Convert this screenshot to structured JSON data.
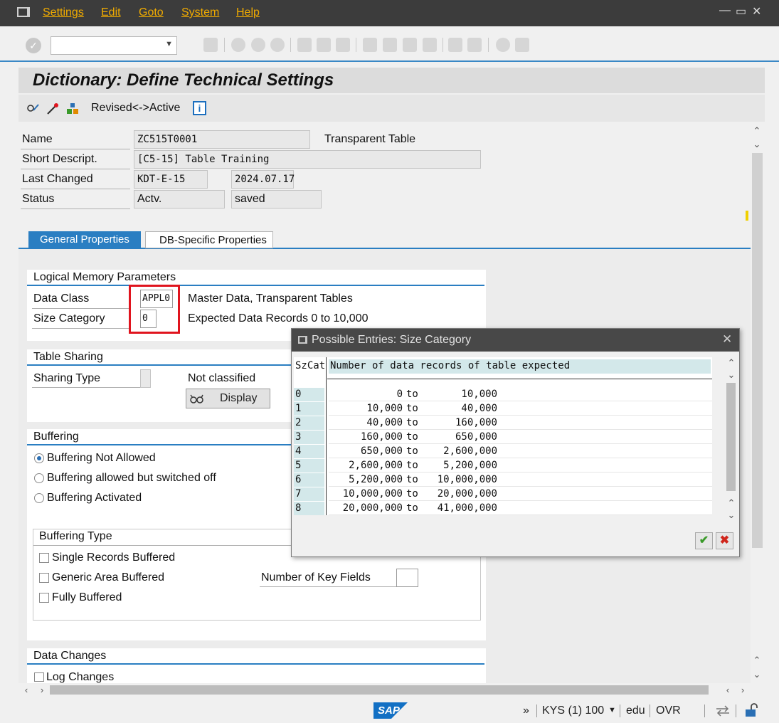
{
  "menu": {
    "items": [
      "Settings",
      "Edit",
      "Goto",
      "System",
      "Help"
    ],
    "window_controls": [
      "—",
      "▭",
      "✕"
    ]
  },
  "page": {
    "title": "Dictionary: Define Technical Settings",
    "app_toolbar": {
      "revised_active": "Revised<->Active",
      "info": "i"
    }
  },
  "header": {
    "name_label": "Name",
    "name_value": "ZC515T0001",
    "table_type": "Transparent Table",
    "short_desc_label": "Short Descript.",
    "short_desc_value": "[C5-15] Table Training",
    "last_changed_label": "Last Changed",
    "last_changed_user": "KDT-E-15",
    "last_changed_date": "2024.07.17",
    "status_label": "Status",
    "status_value": "Actv.",
    "status_saved": "saved"
  },
  "tabs": [
    "General Properties",
    "DB-Specific Properties"
  ],
  "logical_memory": {
    "title": "Logical Memory Parameters",
    "data_class_label": "Data Class",
    "data_class_value": "APPL0",
    "data_class_desc": "Master Data, Transparent Tables",
    "size_category_label": "Size Category",
    "size_category_value": "0",
    "size_category_desc": "Expected Data Records 0 to 10,000"
  },
  "table_sharing": {
    "title": "Table Sharing",
    "sharing_type_label": "Sharing Type",
    "sharing_type_desc": "Not classified",
    "display_button": "Display"
  },
  "buffering": {
    "title": "Buffering",
    "options": [
      "Buffering Not Allowed",
      "Buffering allowed but switched off",
      "Buffering Activated"
    ],
    "selected_index": 0,
    "type_title": "Buffering Type",
    "types": [
      "Single Records Buffered",
      "Generic Area Buffered",
      "Fully Buffered"
    ],
    "key_fields_label": "Number of Key Fields"
  },
  "data_changes": {
    "title": "Data Changes",
    "log_changes": "Log Changes"
  },
  "dialog": {
    "title": "Possible Entries: Size Category",
    "col_key": "SzCat",
    "col_desc": "Number of data records of table expected",
    "to_word": "to",
    "rows": [
      {
        "cat": "0",
        "from": "0",
        "to": "10,000"
      },
      {
        "cat": "1",
        "from": "10,000",
        "to": "40,000"
      },
      {
        "cat": "2",
        "from": "40,000",
        "to": "160,000"
      },
      {
        "cat": "3",
        "from": "160,000",
        "to": "650,000"
      },
      {
        "cat": "4",
        "from": "650,000",
        "to": "2,600,000"
      },
      {
        "cat": "5",
        "from": "2,600,000",
        "to": "5,200,000"
      },
      {
        "cat": "6",
        "from": "5,200,000",
        "to": "10,000,000"
      },
      {
        "cat": "7",
        "from": "10,000,000",
        "to": "20,000,000"
      },
      {
        "cat": "8",
        "from": "20,000,000",
        "to": "41,000,000"
      }
    ],
    "ok_symbol": "✔",
    "cancel_symbol": "✖"
  },
  "status_bar": {
    "logo": "SAP",
    "chevrons": "»",
    "system": "KYS (1) 100",
    "client": "edu",
    "mode": "OVR"
  },
  "colors": {
    "menu_accent": "#f0ab00",
    "tab_active": "#2a7ec2",
    "highlight_box": "#e0141e",
    "key_column": "#d3e8ea",
    "ok_green": "#3a9a2a",
    "cancel_red": "#d0261c"
  }
}
